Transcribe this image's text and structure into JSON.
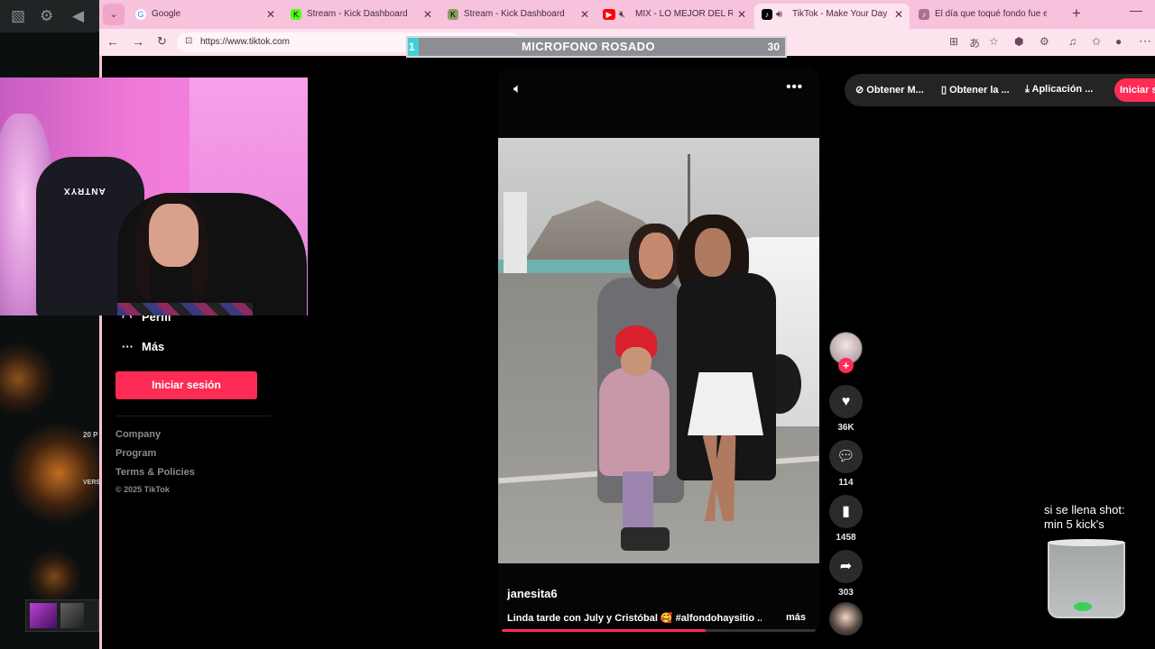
{
  "browser": {
    "tabs": [
      {
        "title": "Google",
        "favicon": "google-icon",
        "color": "#4285f4",
        "active": false
      },
      {
        "title": "Stream - Kick Dashboard",
        "favicon": "kick-icon",
        "color": "#53fc18",
        "active": false
      },
      {
        "title": "Stream - Kick Dashboard",
        "favicon": "kick-icon",
        "color": "#53fc18",
        "active": false
      },
      {
        "title": "MIX - LO MEJOR DEL REGG",
        "favicon": "youtube-icon",
        "color": "#ff0000",
        "active": false
      },
      {
        "title": "TikTok - Make Your Day",
        "favicon": "tiktok-icon",
        "color": "#000000",
        "active": true
      },
      {
        "title": "El día que toqué fondo fue el d",
        "favicon": "tiktok-icon",
        "color": "#000000",
        "active": false
      }
    ],
    "url": "https://www.tiktok.com"
  },
  "overlay": {
    "mic_left": "1",
    "mic_title": "MICROFONO ROSADO",
    "mic_right": "30",
    "shot_line1": "si se llena shot:",
    "shot_line2": "min 5 kick's"
  },
  "webcam": {
    "chair_brand": "ANTRYX"
  },
  "left_panel": {
    "label_a": "20 P",
    "label_b": "VERS"
  },
  "sidebar": {
    "items": [
      {
        "label": "Perfil",
        "icon": "profile-icon"
      },
      {
        "label": "Más",
        "icon": "more-icon"
      }
    ],
    "login_label": "Iniciar sesión",
    "footer": [
      "Company",
      "Program",
      "Terms & Policies"
    ],
    "copyright": "© 2025 TikTok"
  },
  "top_actions": {
    "items": [
      "Obtener M...",
      "Obtener la ...",
      "Aplicación ..."
    ],
    "login_label": "Iniciar se"
  },
  "video": {
    "username": "janesita6",
    "caption": "Linda tarde con July y Cristóbal 🥰 #alfondohaysitio ...",
    "more_label": "más",
    "progress": 0.65,
    "likes": "36K",
    "comments": "114",
    "saves": "1458",
    "shares": "303"
  },
  "colors": {
    "accent": "#fe2c55",
    "tabbar": "#f7c2db"
  }
}
